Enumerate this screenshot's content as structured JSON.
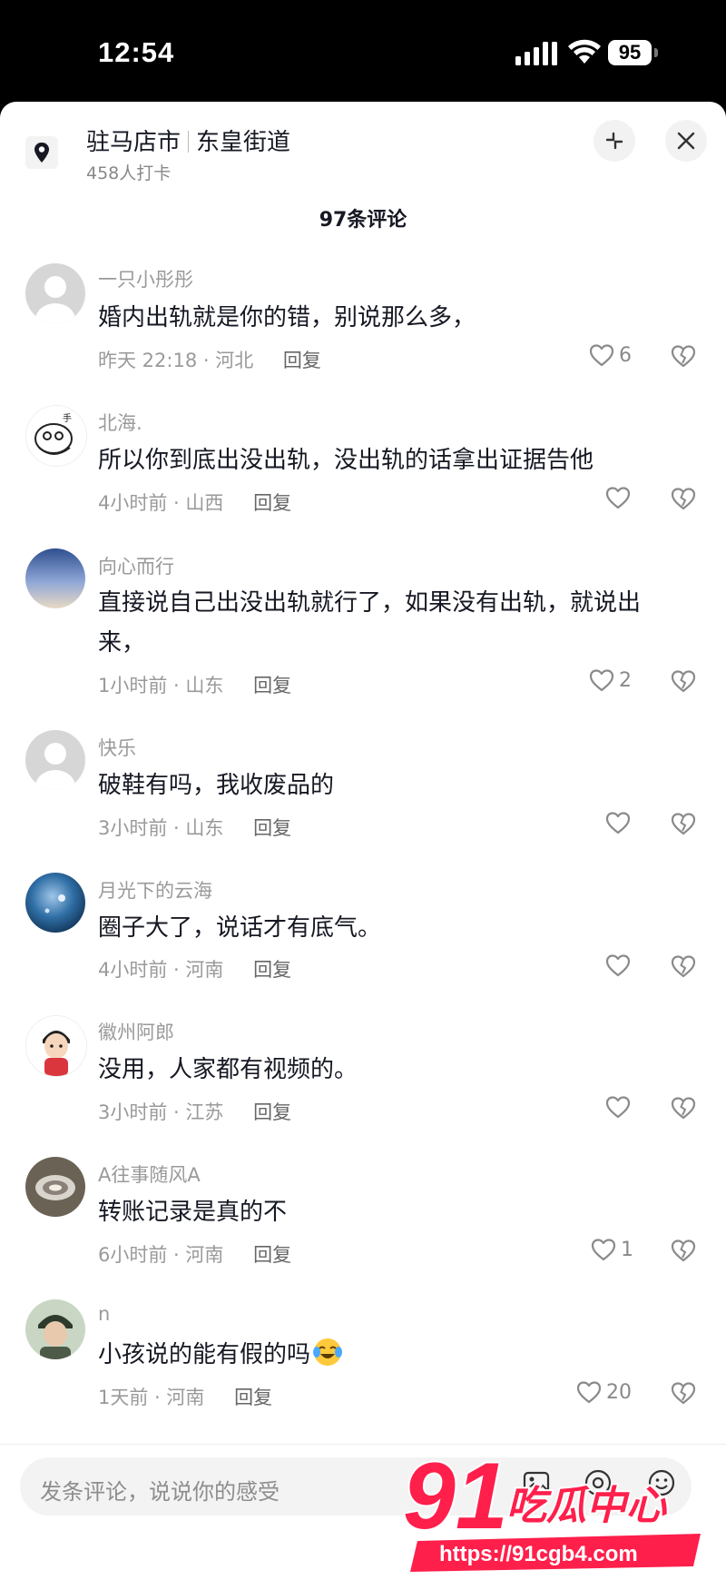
{
  "status_bar": {
    "time": "12:54",
    "battery": "95"
  },
  "location": {
    "name": "驻马店市",
    "area": "东皇街道",
    "checkins": "458人打卡"
  },
  "comments_header": "97条评论",
  "comments": [
    {
      "user": "一只小彤彤",
      "text": "婚内出轨就是你的错，别说那么多，",
      "time": "昨天 22:18",
      "region": "河北",
      "reply": "回复",
      "likes": "6"
    },
    {
      "user": "北海.",
      "text": "所以你到底出没出轨，没出轨的话拿出证据告他",
      "time": "4小时前",
      "region": "山西",
      "reply": "回复",
      "likes": ""
    },
    {
      "user": "向心而行",
      "text": "直接说自己出没出轨就行了，如果没有出轨，就说出来，",
      "time": "1小时前",
      "region": "山东",
      "reply": "回复",
      "likes": "2"
    },
    {
      "user": "快乐",
      "text": "破鞋有吗，我收废品的",
      "time": "3小时前",
      "region": "山东",
      "reply": "回复",
      "likes": ""
    },
    {
      "user": "月光下的云海",
      "text": "圈子大了，说话才有底气。",
      "time": "4小时前",
      "region": "河南",
      "reply": "回复",
      "likes": ""
    },
    {
      "user": "徽州阿郎",
      "text": "没用，人家都有视频的。",
      "time": "3小时前",
      "region": "江苏",
      "reply": "回复",
      "likes": ""
    },
    {
      "user": "A往事随风A",
      "text": "转账记录是真的不",
      "time": "6小时前",
      "region": "河南",
      "reply": "回复",
      "likes": "1"
    },
    {
      "user": "n",
      "text": "小孩说的能有假的吗",
      "time": "1天前",
      "region": "河南",
      "reply": "回复",
      "likes": "20"
    }
  ],
  "comment_input": {
    "placeholder": "发条评论，说说你的感受"
  },
  "watermark": {
    "logo": "91吃瓜中心",
    "url": "https://91cgb4.com"
  },
  "colors": {
    "text_primary": "#161823",
    "text_secondary": "#9a9a9a",
    "watermark_red": "#ff1f4b"
  }
}
